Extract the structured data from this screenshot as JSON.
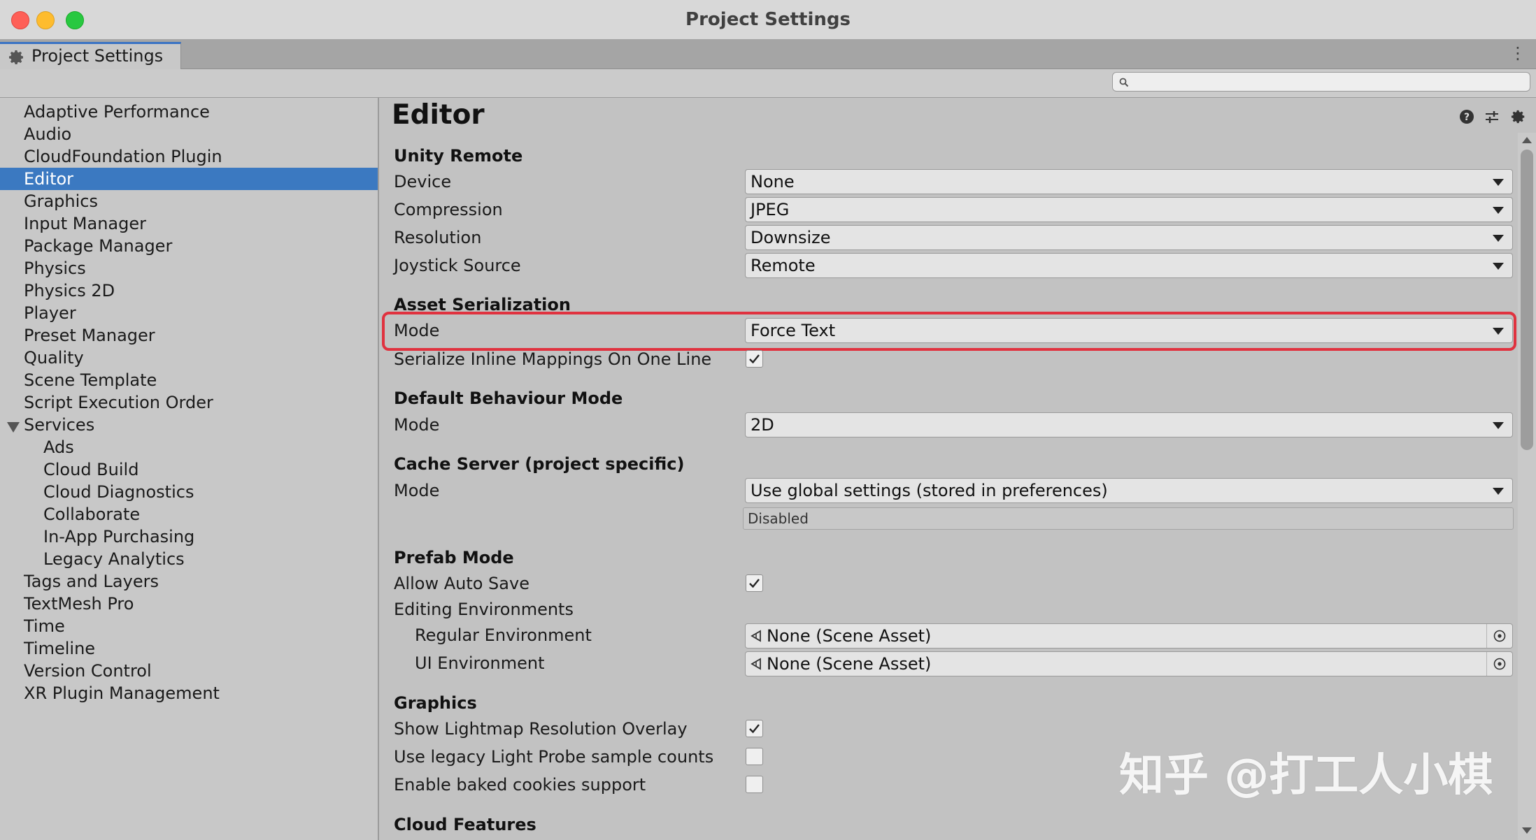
{
  "window": {
    "title": "Project Settings"
  },
  "tab": {
    "label": "Project Settings",
    "icon": "gear-icon"
  },
  "toolbar": {
    "search_placeholder": "",
    "search_icon": "search-icon"
  },
  "colors": {
    "selection": "#3b79c1",
    "highlight": "#e0323f",
    "close": "#fe5f57",
    "minimize": "#febc2e",
    "zoom": "#28c840"
  },
  "sidebar": {
    "items": [
      {
        "label": "Adaptive Performance"
      },
      {
        "label": "Audio"
      },
      {
        "label": "CloudFoundation Plugin"
      },
      {
        "label": "Editor",
        "selected": true
      },
      {
        "label": "Graphics"
      },
      {
        "label": "Input Manager"
      },
      {
        "label": "Package Manager"
      },
      {
        "label": "Physics"
      },
      {
        "label": "Physics 2D"
      },
      {
        "label": "Player"
      },
      {
        "label": "Preset Manager"
      },
      {
        "label": "Quality"
      },
      {
        "label": "Scene Template"
      },
      {
        "label": "Script Execution Order"
      },
      {
        "label": "Services",
        "expanded": true
      },
      {
        "label": "Ads",
        "child": true
      },
      {
        "label": "Cloud Build",
        "child": true
      },
      {
        "label": "Cloud Diagnostics",
        "child": true
      },
      {
        "label": "Collaborate",
        "child": true
      },
      {
        "label": "In-App Purchasing",
        "child": true
      },
      {
        "label": "Legacy Analytics",
        "child": true
      },
      {
        "label": "Tags and Layers"
      },
      {
        "label": "TextMesh Pro"
      },
      {
        "label": "Time"
      },
      {
        "label": "Timeline"
      },
      {
        "label": "Version Control"
      },
      {
        "label": "XR Plugin Management"
      }
    ]
  },
  "main": {
    "title": "Editor",
    "header_icons": [
      "help-icon",
      "preset-sliders-icon",
      "settings-gear-icon"
    ],
    "unity_remote": {
      "title": "Unity Remote",
      "device_label": "Device",
      "device_value": "None",
      "compression_label": "Compression",
      "compression_value": "JPEG",
      "resolution_label": "Resolution",
      "resolution_value": "Downsize",
      "joystick_label": "Joystick Source",
      "joystick_value": "Remote"
    },
    "asset_serialization": {
      "title": "Asset Serialization",
      "mode_label": "Mode",
      "mode_value": "Force Text",
      "inline_label": "Serialize Inline Mappings On One Line",
      "inline_checked": true
    },
    "default_behaviour": {
      "title": "Default Behaviour Mode",
      "mode_label": "Mode",
      "mode_value": "2D"
    },
    "cache_server": {
      "title": "Cache Server (project specific)",
      "mode_label": "Mode",
      "mode_value": "Use global settings (stored in preferences)",
      "status": "Disabled"
    },
    "prefab_mode": {
      "title": "Prefab Mode",
      "auto_save_label": "Allow Auto Save",
      "auto_save_checked": true,
      "editing_env_label": "Editing Environments",
      "regular_env_label": "Regular Environment",
      "regular_env_value": "None (Scene Asset)",
      "ui_env_label": "UI Environment",
      "ui_env_value": "None (Scene Asset)"
    },
    "graphics": {
      "title": "Graphics",
      "lightmap_label": "Show Lightmap Resolution Overlay",
      "lightmap_checked": true,
      "light_probe_label": "Use legacy Light Probe sample counts",
      "light_probe_checked": false,
      "cookies_label": "Enable baked cookies support",
      "cookies_checked": false
    },
    "cloud_features": {
      "title": "Cloud Features"
    }
  },
  "watermark": "知乎 @打工人小棋"
}
